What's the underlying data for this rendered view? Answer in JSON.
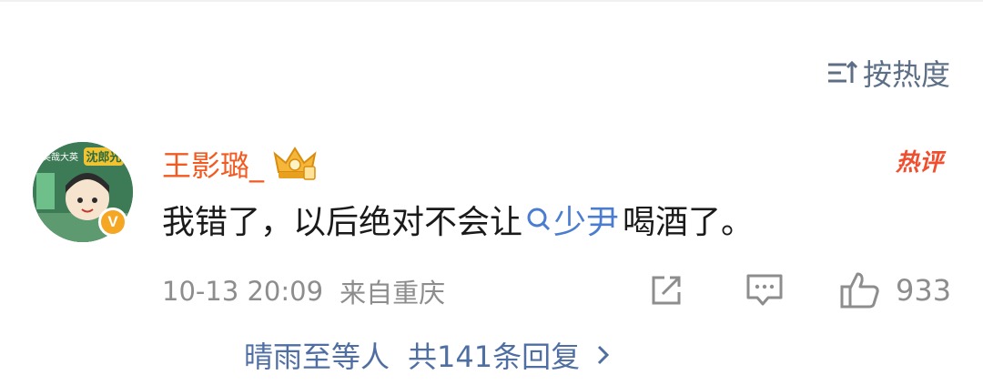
{
  "sort": {
    "label": "按热度",
    "icon": "sort-icon"
  },
  "comment": {
    "username": "王影璐_",
    "avatar_text_top": "美哉大英",
    "avatar_text_name": "沈郎光",
    "verified_badge": "V",
    "hot_tag": "热评",
    "content_before": "我错了，以后绝对不会让",
    "mention": "少尹",
    "content_after": " 喝酒了。",
    "time": "10-13 20:09",
    "location": "来自重庆",
    "like_count": "933",
    "replies_summary": "晴雨至等人",
    "replies_total": "共141条回复",
    "colors": {
      "username": "#f25a21",
      "mention": "#4a7ccf",
      "hot": "#f04e2f",
      "meta": "#8d8d8d",
      "reply_link": "#4f6fa3"
    }
  }
}
